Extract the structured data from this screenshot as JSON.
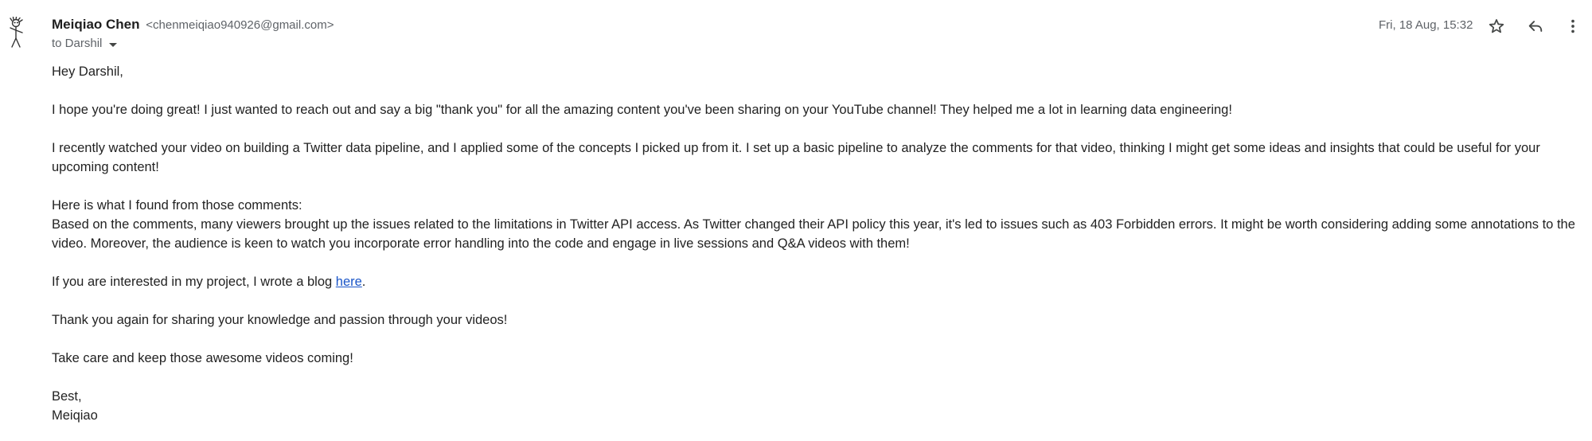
{
  "sender": {
    "name": "Meiqiao Chen",
    "email": "<chenmeiqiao940926@gmail.com>"
  },
  "recipient": {
    "label": "to Darshil"
  },
  "timestamp": "Fri, 18 Aug, 15:32",
  "actions": {
    "star_icon": "star-outline-icon",
    "reply_icon": "reply-icon",
    "more_icon": "more-vertical-icon"
  },
  "avatar": {
    "icon": "stick-figure-avatar-icon"
  },
  "body": {
    "greeting": "Hey Darshil,",
    "para1": "I hope you're doing great! I just wanted to reach out and say a big \"thank you\" for all the amazing content you've been sharing on your YouTube channel! They helped me a lot in learning data engineering!",
    "para2": "I recently watched your video on building a Twitter data pipeline, and I applied some of the concepts I picked up from it. I set up a basic pipeline to analyze the comments for that video, thinking I might get some ideas and insights that could be useful for your upcoming content!",
    "para3_line1": "Here is what I found from those comments:",
    "para3_line2": "Based on the comments, many viewers brought up the issues related to the limitations in Twitter API access. As Twitter changed their API policy this year, it's led to issues such as 403 Forbidden errors. It might be worth considering adding some annotations to the video. Moreover, the audience is keen to watch you incorporate error handling into the code and engage in live sessions and Q&A videos with them!",
    "para4_prefix": "If you are interested in my project, I wrote a blog ",
    "para4_link": "here",
    "para4_suffix": ".",
    "para5": "Thank you again for sharing your knowledge and passion through your videos!",
    "para6": "Take care and keep those awesome videos coming!",
    "signoff": "Best,",
    "signature": "Meiqiao"
  }
}
